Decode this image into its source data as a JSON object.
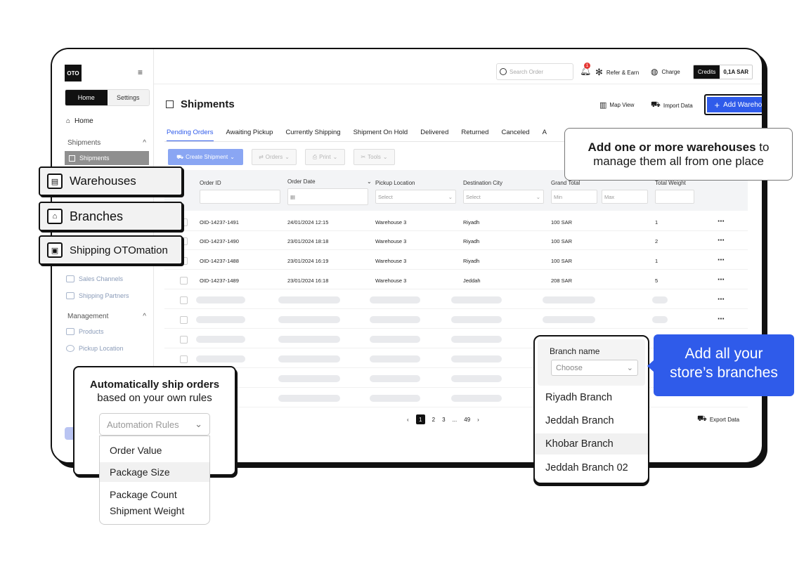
{
  "sidebar": {
    "logo": "OTO",
    "seg_home": "Home",
    "seg_settings": "Settings",
    "home": "Home",
    "shipments_section": "Shipments",
    "shipments_active": "Shipments",
    "sales_channels": "Sales Channels",
    "shipping_partners": "Shipping Partners",
    "management_section": "Management",
    "products": "Products",
    "pickup_location": "Pickup Location"
  },
  "topbar": {
    "search_placeholder": "Search Order",
    "bell_count": "1",
    "refer": "Refer & Earn",
    "charge": "Charge",
    "credits_label": "Credits",
    "credits_value": "0,1A SAR"
  },
  "page": {
    "title": "Shipments",
    "map_view": "Map View",
    "import_data": "Import Data",
    "add_warehouse": "Add Warehouse"
  },
  "tabs": [
    "Pending Orders",
    "Awaiting Pickup",
    "Currently Shipping",
    "Shipment On Hold",
    "Delivered",
    "Returned",
    "Canceled",
    "A"
  ],
  "toolbar": {
    "create": "Create Shipment",
    "orders": "Orders",
    "print": "Print",
    "tools": "Tools"
  },
  "table": {
    "headers": [
      "Order ID",
      "Order Date",
      "Pickup Location",
      "Destination City",
      "Grand Total",
      "Total Weight"
    ],
    "select": "Select",
    "min": "Min",
    "max": "Max",
    "rows": [
      [
        "OID-14237-1491",
        "24/01/2024 12:15",
        "Warehouse 3",
        "Riyadh",
        "100 SAR",
        "1"
      ],
      [
        "OID-14237-1490",
        "23/01/2024 18:18",
        "Warehouse 3",
        "Riyadh",
        "100 SAR",
        "2"
      ],
      [
        "OID-14237-1488",
        "23/01/2024 16:19",
        "Warehouse 3",
        "Riyadh",
        "100 SAR",
        "1"
      ],
      [
        "OID-14237-1489",
        "23/01/2024 16:18",
        "Warehouse 3",
        "Jeddah",
        "208 SAR",
        "5"
      ]
    ],
    "more": "⋯"
  },
  "pager": {
    "prev": "‹",
    "p1": "1",
    "p2": "2",
    "p3": "3",
    "dots": "...",
    "last": "49",
    "next": "›"
  },
  "export": "Export Data",
  "overlays": {
    "warehouses": "Warehouses",
    "branches": "Branches",
    "shipping_otomation": "Shipping OTOmation",
    "wh_callout_bold": "Add one or more warehouses",
    "wh_callout_rest1": " to",
    "wh_callout_rest2": "manage them all from one place",
    "auto_title": "Automatically ship orders",
    "auto_sub": "based on your own rules",
    "auto_select": "Automation Rules",
    "auto_options": [
      "Order Value",
      "Package Size",
      "Package Count",
      "Shipment Weight"
    ],
    "branch_label": "Branch name",
    "branch_select": "Choose",
    "branches_list": [
      "Riyadh Branch",
      "Jeddah Branch",
      "Khobar Branch",
      "Jeddah Branch 02"
    ],
    "blue_line1": "Add all your",
    "blue_line2": "store’s branches"
  },
  "colors": {
    "accent": "#2f5bea",
    "dark": "#111111"
  }
}
